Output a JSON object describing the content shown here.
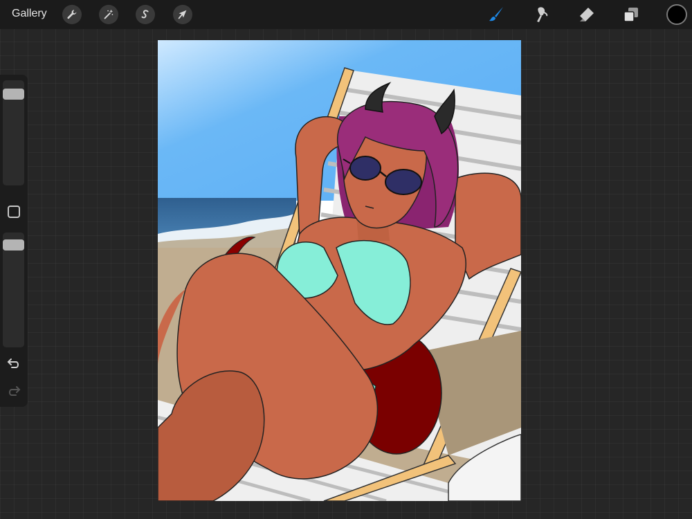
{
  "topbar": {
    "gallery_label": "Gallery",
    "left_tools": [
      {
        "name": "actions",
        "icon": "wrench-icon"
      },
      {
        "name": "adjustments",
        "icon": "magic-wand-icon"
      },
      {
        "name": "selection",
        "icon": "selection-s-icon"
      },
      {
        "name": "transform",
        "icon": "arrow-cursor-icon"
      }
    ],
    "right_tools": [
      {
        "name": "brush",
        "icon": "brush-icon",
        "active": true
      },
      {
        "name": "smudge",
        "icon": "smudge-icon"
      },
      {
        "name": "eraser",
        "icon": "eraser-icon"
      },
      {
        "name": "layers",
        "icon": "layers-icon"
      }
    ],
    "current_color": "#000000",
    "accent_color": "#1e88e5"
  },
  "sidebar": {
    "brush_size_level": 0.95,
    "opacity_level": 0.98,
    "icons": [
      "modify-square-icon",
      "undo-icon",
      "redo-icon"
    ]
  },
  "canvas": {
    "content": "beach-illustration",
    "colors": {
      "sky": "#66b6f7",
      "ocean": "#3a6e9a",
      "sand": "#c0ad90",
      "skin": "#c9694a",
      "hair": "#9a2d7a",
      "bikini": "#86eed8",
      "chair_wood": "#f2c27a",
      "tail": "#7a0000"
    }
  }
}
